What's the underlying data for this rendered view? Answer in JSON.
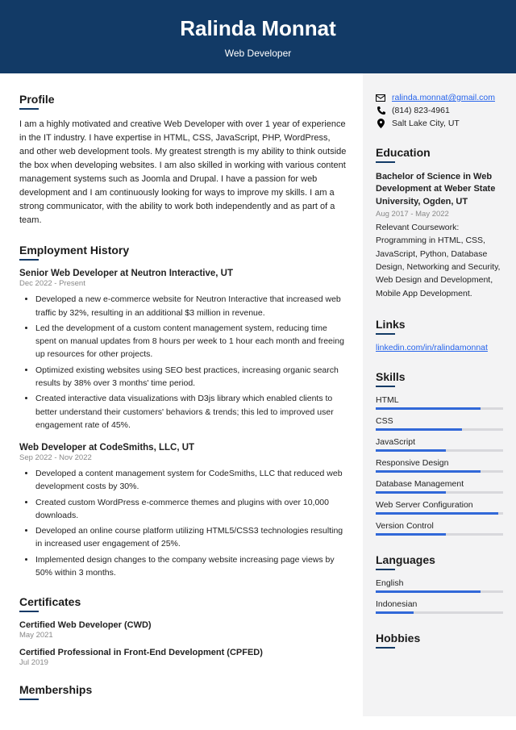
{
  "header": {
    "name": "Ralinda Monnat",
    "role": "Web Developer"
  },
  "contact": {
    "email": "ralinda.monnat@gmail.com",
    "phone": "(814) 823-4961",
    "location": "Salt Lake City, UT"
  },
  "profile": {
    "title": "Profile",
    "text": "I am a highly motivated and creative Web Developer with over 1 year of experience in the IT industry. I have expertise in HTML, CSS, JavaScript, PHP, WordPress, and other web development tools. My greatest strength is my ability to think outside the box when developing websites. I am also skilled in working with various content management systems such as Joomla and Drupal. I have a passion for web development and I am continuously looking for ways to improve my skills. I am a strong communicator, with the ability to work both independently and as part of a team."
  },
  "employment": {
    "title": "Employment History",
    "jobs": [
      {
        "title": "Senior Web Developer at Neutron Interactive, UT",
        "dates": "Dec 2022 - Present",
        "bullets": [
          "Developed a new e-commerce website for Neutron Interactive that increased web traffic by 32%, resulting in an additional $3 million in revenue.",
          "Led the development of a custom content management system, reducing time spent on manual updates from 8 hours per week to 1 hour each month and freeing up resources for other projects.",
          "Optimized existing websites using SEO best practices, increasing organic search results by 38% over 3 months' time period.",
          "Created interactive data visualizations with D3js library which enabled clients to better understand their customers' behaviors & trends; this led to improved user engagement rate of 45%."
        ]
      },
      {
        "title": "Web Developer at CodeSmiths, LLC, UT",
        "dates": "Sep 2022 - Nov 2022",
        "bullets": [
          "Developed a content management system for CodeSmiths, LLC that reduced web development costs by 30%.",
          "Created custom WordPress e-commerce themes and plugins with over 10,000 downloads.",
          "Developed an online course platform utilizing HTML5/CSS3 technologies resulting in increased user engagement of 25%.",
          "Implemented design changes to the company website increasing page views by 50% within 3 months."
        ]
      }
    ]
  },
  "certificates": {
    "title": "Certificates",
    "items": [
      {
        "name": "Certified Web Developer (CWD)",
        "date": "May 2021"
      },
      {
        "name": "Certified Professional in Front-End Development (CPFED)",
        "date": "Jul 2019"
      }
    ]
  },
  "memberships": {
    "title": "Memberships"
  },
  "education": {
    "title": "Education",
    "degree": "Bachelor of Science in Web Development at Weber State University, Ogden, UT",
    "dates": "Aug 2017 - May 2022",
    "text": "Relevant Coursework: Programming in HTML, CSS, JavaScript, Python, Database Design, Networking and Security, Web Design and Development, Mobile App Development."
  },
  "links": {
    "title": "Links",
    "url": "linkedin.com/in/ralindamonnat"
  },
  "skills": {
    "title": "Skills",
    "items": [
      {
        "name": "HTML",
        "level": 82
      },
      {
        "name": "CSS",
        "level": 68
      },
      {
        "name": "JavaScript",
        "level": 55
      },
      {
        "name": "Responsive Design",
        "level": 82
      },
      {
        "name": "Database Management",
        "level": 55
      },
      {
        "name": "Web Server Configuration",
        "level": 96
      },
      {
        "name": "Version Control",
        "level": 55
      }
    ]
  },
  "languages": {
    "title": "Languages",
    "items": [
      {
        "name": "English",
        "level": 82
      },
      {
        "name": "Indonesian",
        "level": 30
      }
    ]
  },
  "hobbies": {
    "title": "Hobbies"
  }
}
